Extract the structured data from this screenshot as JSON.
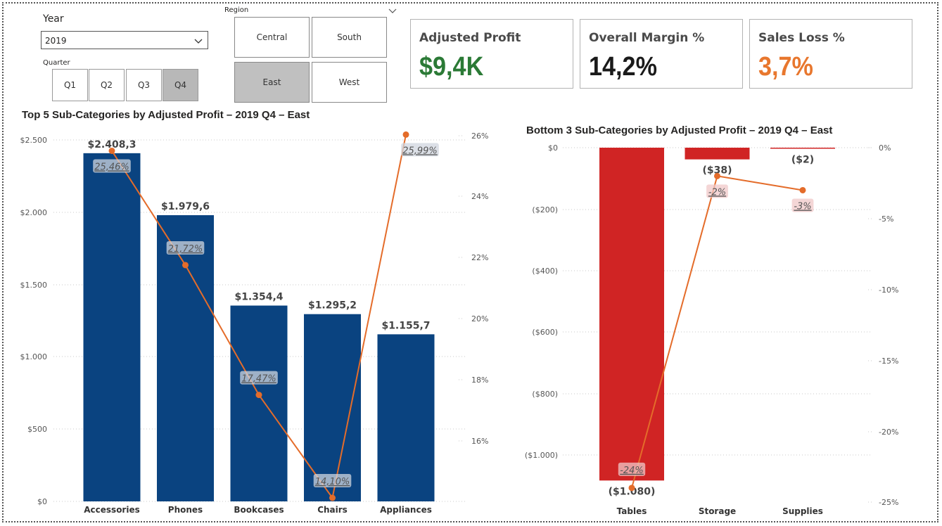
{
  "filters": {
    "year": {
      "label": "Year",
      "selected": "2019"
    },
    "quarter": {
      "label": "Quarter",
      "options": [
        "Q1",
        "Q2",
        "Q3",
        "Q4"
      ],
      "selected": "Q4"
    },
    "region": {
      "label": "Region",
      "options": [
        "Central",
        "South",
        "East",
        "West"
      ],
      "selected": "East"
    }
  },
  "cards": [
    {
      "title": "Adjusted Profit",
      "value": "$9,4K",
      "color": "#2b7a36"
    },
    {
      "title": "Overall Margin %",
      "value": "14,2%",
      "color": "#1a1a1a"
    },
    {
      "title": "Sales Loss %",
      "value": "3,7%",
      "color": "#e8772e"
    }
  ],
  "colors": {
    "bar_top": "#0a4380",
    "bar_bottom": "#d02424",
    "line": "#e46c2a"
  },
  "chart_data": [
    {
      "type": "bar",
      "title": "Top 5 Sub-Categories by Adjusted Profit – 2019 Q4 – East",
      "categories": [
        "Accessories",
        "Phones",
        "Bookcases",
        "Chairs",
        "Appliances"
      ],
      "series": [
        {
          "values": [
            2408.3,
            1979.6,
            1354.4,
            1295.2,
            1155.7
          ],
          "labels": [
            "$2.408,3",
            "$1.979,6",
            "$1.354,4",
            "$1.295,2",
            "$1.155,7"
          ]
        },
        {
          "type": "line",
          "values": [
            25.46,
            21.72,
            17.47,
            14.1,
            25.99
          ],
          "labels": [
            "25,46%",
            "21,72%",
            "17,47%",
            "14,10%",
            "25,99%"
          ]
        }
      ],
      "y_ticks": [
        "$0",
        "$500",
        "$1.000",
        "$1.500",
        "$2.000",
        "$2.500"
      ],
      "ylim": [
        0,
        2500
      ],
      "y2_ticks": [
        "16%",
        "18%",
        "20%",
        "22%",
        "24%",
        "26%"
      ],
      "y2lim": [
        14.1,
        26
      ],
      "grid": true
    },
    {
      "type": "bar",
      "title": "Bottom 3 Sub-Categories by Adjusted Profit – 2019 Q4 – East",
      "categories": [
        "Tables",
        "Storage",
        "Supplies"
      ],
      "series": [
        {
          "values": [
            -1080,
            -38,
            -2
          ],
          "labels": [
            "($1.080)",
            "($38)",
            "($2)"
          ]
        },
        {
          "type": "line",
          "values": [
            -24,
            -2,
            -3
          ],
          "labels": [
            "-24%",
            "-2%",
            "-3%"
          ]
        }
      ],
      "y_ticks": [
        "$0",
        "($200)",
        "($400)",
        "($600)",
        "($800)",
        "($1.000)"
      ],
      "ylim": [
        -1150,
        0
      ],
      "y2_ticks": [
        "0%",
        "-5%",
        "-10%",
        "-15%",
        "-20%",
        "-25%"
      ],
      "y2lim": [
        -25,
        0
      ],
      "grid": true
    }
  ]
}
